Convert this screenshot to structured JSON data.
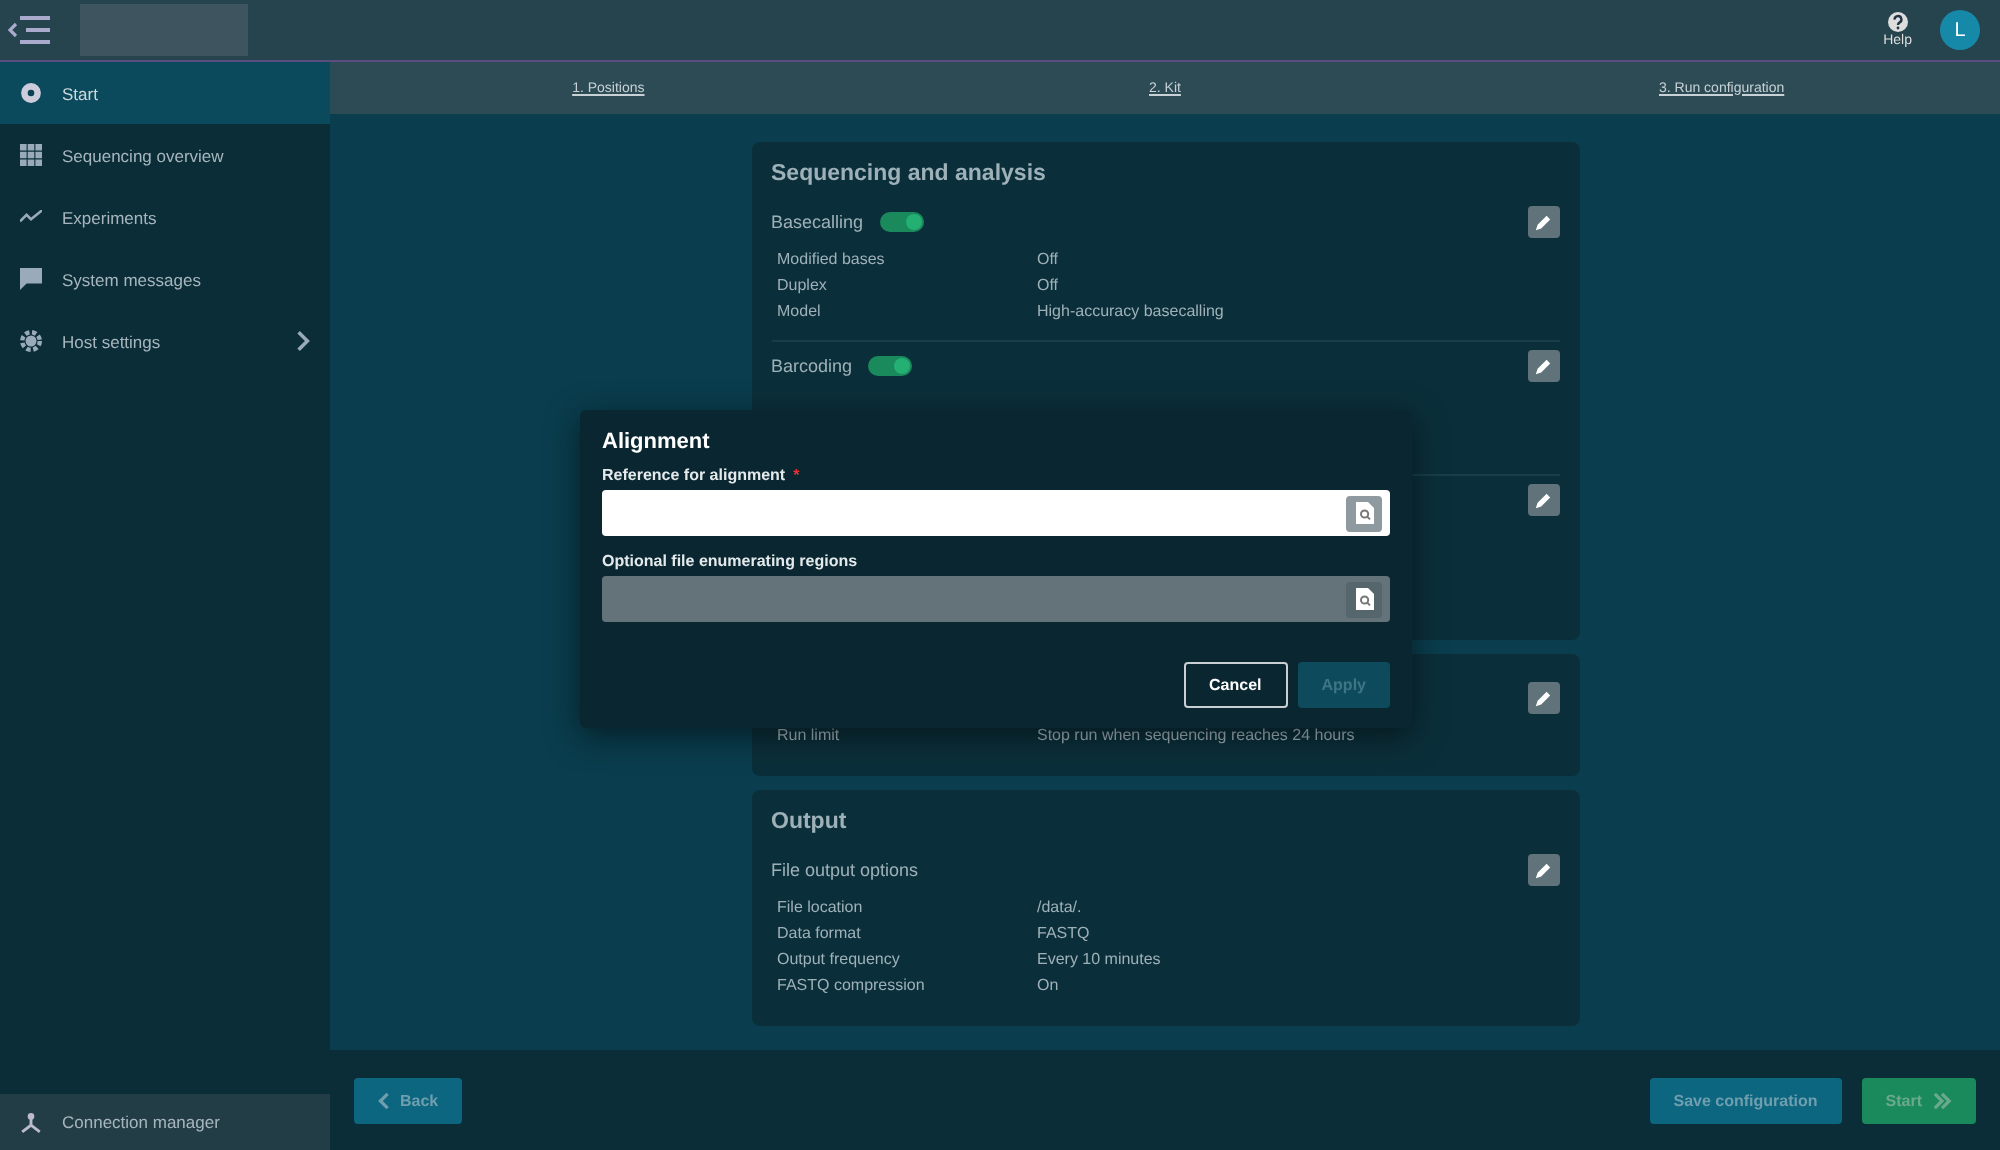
{
  "topbar": {
    "help_label": "Help",
    "avatar_initial": "L"
  },
  "sidebar": {
    "items": [
      {
        "label": "Start",
        "selected": true,
        "has_submenu": false
      },
      {
        "label": "Sequencing overview",
        "selected": false,
        "has_submenu": false
      },
      {
        "label": "Experiments",
        "selected": false,
        "has_submenu": false
      },
      {
        "label": "System messages",
        "selected": false,
        "has_submenu": false
      },
      {
        "label": "Host settings",
        "selected": false,
        "has_submenu": true
      }
    ],
    "footer_item": "Connection manager"
  },
  "steps": [
    "1. Positions",
    "2. Kit",
    "3. Run configuration"
  ],
  "cards": [
    {
      "title": "Sequencing and analysis",
      "sections": [
        {
          "label": "Basecalling",
          "toggle_on": true,
          "rows": [
            {
              "name": "Modified bases",
              "value": "Off"
            },
            {
              "name": "Duplex",
              "value": "Off"
            },
            {
              "name": "Model",
              "value": "High-accuracy basecalling"
            }
          ]
        },
        {
          "label": "Barcoding",
          "toggle_on": true
        },
        {
          "kind": "covered"
        }
      ]
    },
    {
      "sections": [
        {
          "rows": [
            {
              "name": "Run limit",
              "value": "Stop run when sequencing reaches 24 hours"
            }
          ]
        }
      ]
    },
    {
      "title": "Output",
      "sections": [
        {
          "label": "File output options",
          "rows": [
            {
              "name": "File location",
              "value": "/data/."
            },
            {
              "name": "Data format",
              "value": "FASTQ"
            },
            {
              "name": "Output frequency",
              "value": "Every 10 minutes"
            },
            {
              "name": "FASTQ compression",
              "value": "On"
            }
          ]
        }
      ]
    }
  ],
  "footer": {
    "back": "Back",
    "save": "Save configuration",
    "start": "Start"
  },
  "dialog": {
    "title": "Alignment",
    "required_mark": "*",
    "fields": [
      {
        "label": "Reference for alignment",
        "required": true,
        "disabled": false
      },
      {
        "label": "Optional file enumerating regions",
        "required": false,
        "disabled": true
      }
    ],
    "cancel": "Cancel",
    "apply": "Apply",
    "apply_disabled": true
  }
}
